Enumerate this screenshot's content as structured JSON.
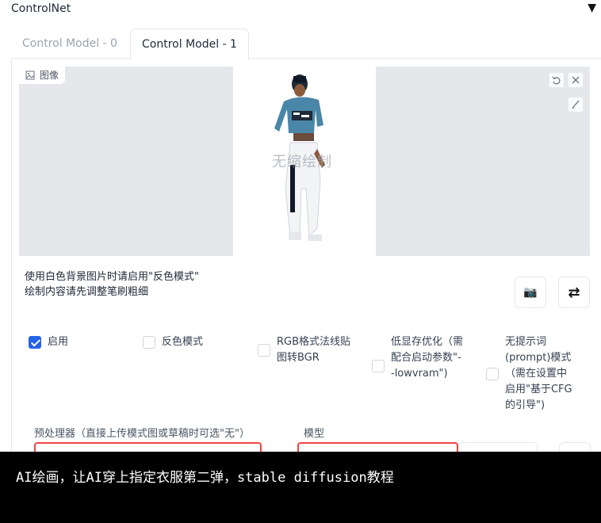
{
  "header": {
    "title": "ControlNet",
    "collapse_icon": "triangle-down-icon"
  },
  "tabs": [
    {
      "label": "Control Model - 0",
      "active": false
    },
    {
      "label": "Control Model - 1",
      "active": true
    }
  ],
  "image_upload": {
    "label": "图像",
    "icon": "image-icon"
  },
  "watermark": "无缩绘制",
  "canvas_tools": {
    "reset_icon": "undo-icon",
    "close_icon": "close-icon",
    "brush_icon": "brush-icon"
  },
  "hints": [
    "使用白色背景图片时请启用\"反色模式\"",
    "绘制内容请先调整笔刷粗细"
  ],
  "tool_buttons": {
    "camera_icon": "camera-icon",
    "swap_icon": "swap-icon",
    "camera_glyph": "📷",
    "swap_glyph": "⇄"
  },
  "options": {
    "enable": {
      "label": "启用",
      "checked": true
    },
    "invert": {
      "label": "反色模式",
      "checked": false
    },
    "rgb_bgr": {
      "label": "RGB格式法线贴图转BGR",
      "checked": false
    },
    "lowvram": {
      "label": "低显存优化（需配合启动参数\"--lowvram\")",
      "checked": false
    },
    "guess_mode": {
      "label": "无提示词(prompt)模式（需在设置中启用\"基于CFG的引导\")",
      "checked": false
    }
  },
  "preprocessor": {
    "label": "预处理器（直接上传模式图或草稿时可选\"无\"）"
  },
  "model": {
    "label": "模型"
  },
  "caption": "AI绘画，让AI穿上指定衣服第二弹，stable diffusion教程",
  "colors": {
    "accent": "#2563eb",
    "highlight": "#ef4444",
    "panel": "#e5e7eb"
  }
}
